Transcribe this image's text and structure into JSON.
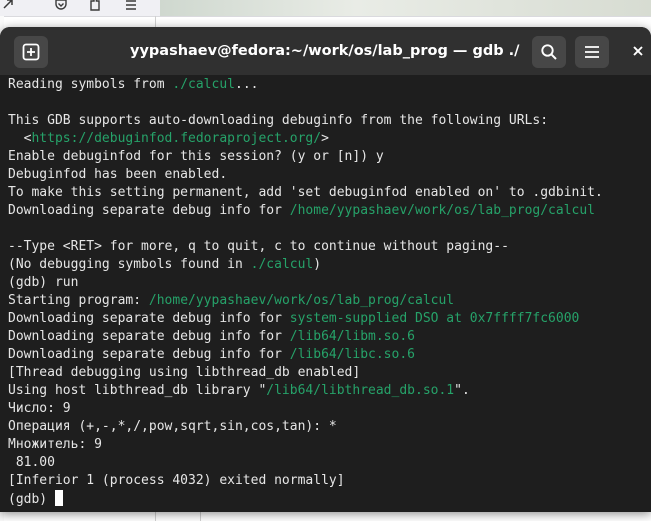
{
  "terminal": {
    "title": "yypashaev@fedora:~/work/os/lab_prog — gdb ./calcul",
    "new_tab_icon": "plus-square-icon",
    "search_icon": "search-icon",
    "menu_icon": "hamburger-menu-icon",
    "close_icon": "close-icon",
    "colors": {
      "background": "#1e1e1e",
      "text": "#e6e6e6",
      "path": "#26a269",
      "titlebar": "#303030"
    },
    "lines": [
      {
        "parts": [
          {
            "t": "Reading symbols from "
          },
          {
            "t": "./calcul",
            "c": "path"
          },
          {
            "t": "..."
          }
        ]
      },
      {
        "parts": []
      },
      {
        "parts": [
          {
            "t": "This GDB supports auto-downloading debuginfo from the following URLs:"
          }
        ]
      },
      {
        "parts": [
          {
            "t": "  <"
          },
          {
            "t": "https://debuginfod.fedoraproject.org/",
            "c": "path"
          },
          {
            "t": ">"
          }
        ]
      },
      {
        "parts": [
          {
            "t": "Enable debuginfod for this session? (y or [n]) y"
          }
        ]
      },
      {
        "parts": [
          {
            "t": "Debuginfod has been enabled."
          }
        ]
      },
      {
        "parts": [
          {
            "t": "To make this setting permanent, add 'set debuginfod enabled on' to .gdbinit."
          }
        ]
      },
      {
        "parts": [
          {
            "t": "Downloading separate debug info for "
          },
          {
            "t": "/home/yypashaev/work/os/lab_prog/calcul",
            "c": "path"
          }
        ]
      },
      {
        "parts": []
      },
      {
        "parts": [
          {
            "t": "--Type <RET> for more, q to quit, c to continue without paging--"
          }
        ]
      },
      {
        "parts": [
          {
            "t": "(No debugging symbols found in "
          },
          {
            "t": "./calcul",
            "c": "path"
          },
          {
            "t": ")"
          }
        ]
      },
      {
        "parts": [
          {
            "t": "(gdb) run"
          }
        ]
      },
      {
        "parts": [
          {
            "t": "Starting program: "
          },
          {
            "t": "/home/yypashaev/work/os/lab_prog/calcul",
            "c": "path"
          }
        ]
      },
      {
        "parts": [
          {
            "t": "Downloading separate debug info for "
          },
          {
            "t": "system-supplied DSO at 0x7ffff7fc6000",
            "c": "path"
          }
        ]
      },
      {
        "parts": [
          {
            "t": "Downloading separate debug info for "
          },
          {
            "t": "/lib64/libm.so.6",
            "c": "path"
          }
        ]
      },
      {
        "parts": [
          {
            "t": "Downloading separate debug info for "
          },
          {
            "t": "/lib64/libc.so.6",
            "c": "path"
          }
        ]
      },
      {
        "parts": [
          {
            "t": "[Thread debugging using libthread_db enabled]"
          }
        ]
      },
      {
        "parts": [
          {
            "t": "Using host libthread_db library \""
          },
          {
            "t": "/lib64/libthread_db.so.1",
            "c": "path"
          },
          {
            "t": "\"."
          }
        ]
      },
      {
        "parts": [
          {
            "t": "Число: 9"
          }
        ]
      },
      {
        "parts": [
          {
            "t": "Операция (+,-,*,/,pow,sqrt,sin,cos,tan): *"
          }
        ]
      },
      {
        "parts": [
          {
            "t": "Множитель: 9"
          }
        ]
      },
      {
        "parts": [
          {
            "t": " 81.00"
          }
        ]
      },
      {
        "parts": [
          {
            "t": "[Inferior 1 (process 4032) exited normally]"
          }
        ]
      },
      {
        "parts": [
          {
            "t": "(gdb) "
          }
        ],
        "cursor": true
      }
    ]
  },
  "background_browser": {
    "icons": [
      "arrow-icon",
      "pocket-icon",
      "extensions-icon",
      "menu-icon"
    ]
  }
}
